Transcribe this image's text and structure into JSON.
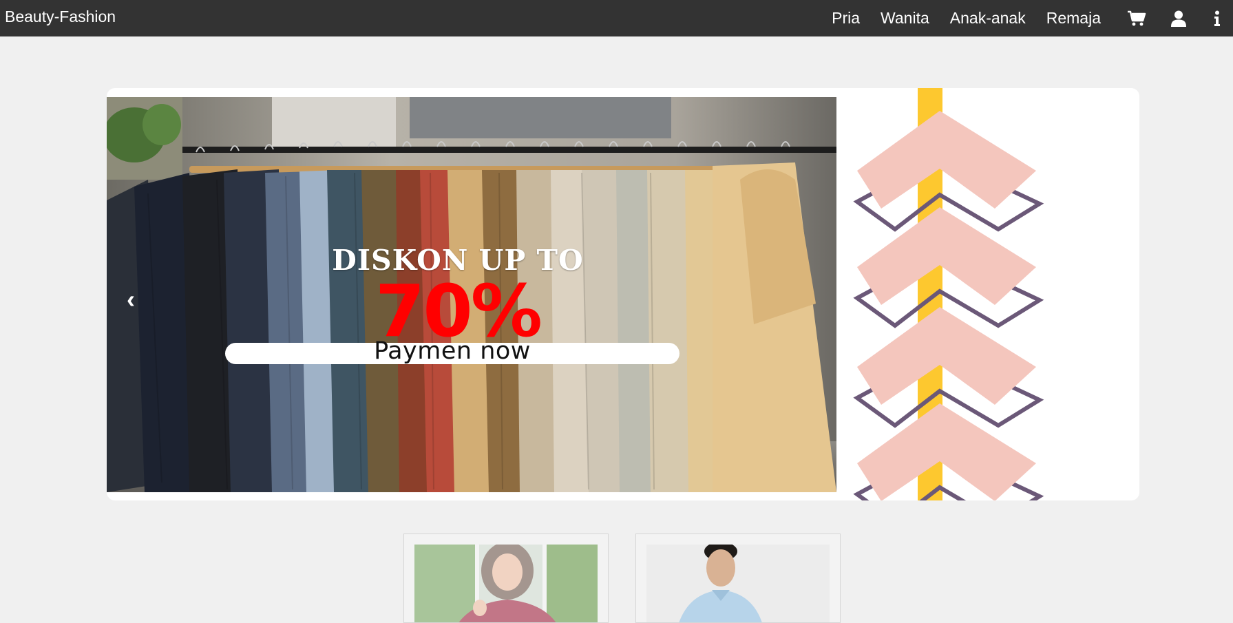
{
  "header": {
    "brand": "Beauty-Fashion",
    "nav_links": [
      "Pria",
      "Wanita",
      "Anak-anak",
      "Remaja"
    ],
    "icons": [
      "cart-icon",
      "user-icon",
      "info-icon"
    ]
  },
  "banner": {
    "heading": "DISKON UP TO",
    "discount": "70%",
    "cta_label": "Paymen now",
    "prev_arrow": "‹",
    "colors": {
      "discount": "#ff0000",
      "stripe": "#fdc82f",
      "chevron_fill": "#f4c6bd",
      "chevron_outline": "#6b5878"
    }
  },
  "products": [
    {
      "image": "woman-in-hijab-photo"
    },
    {
      "image": "man-in-blue-shirt-photo"
    }
  ],
  "colors": {
    "navbar": "#333333",
    "page_background": "#f0f0f0"
  }
}
